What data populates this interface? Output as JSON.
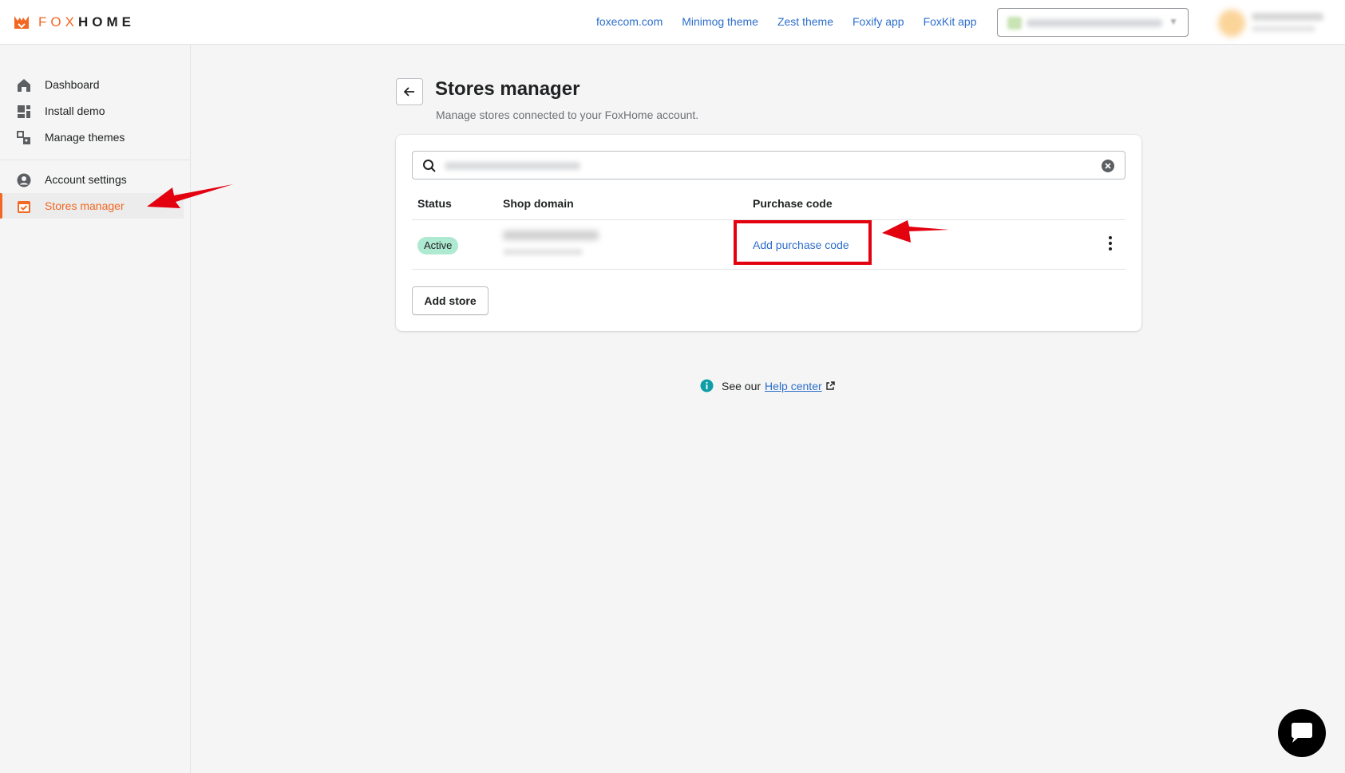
{
  "brand": {
    "name_fox": "FOX",
    "name_home": "HOME",
    "accent": "#f26722",
    "link_color": "#2c6ecb"
  },
  "top_nav": {
    "links": [
      "foxecom.com",
      "Minimog theme",
      "Zest theme",
      "Foxify app",
      "FoxKit app"
    ]
  },
  "sidebar": {
    "items": [
      {
        "label": "Dashboard",
        "icon": "home-icon"
      },
      {
        "label": "Install demo",
        "icon": "layout-icon"
      },
      {
        "label": "Manage themes",
        "icon": "themes-icon"
      },
      {
        "label": "Account settings",
        "icon": "account-icon"
      },
      {
        "label": "Stores manager",
        "icon": "store-icon",
        "active": true
      }
    ]
  },
  "page": {
    "title": "Stores manager",
    "subtitle": "Manage stores connected to your FoxHome account."
  },
  "table": {
    "headers": {
      "status": "Status",
      "domain": "Shop domain",
      "purchase": "Purchase code"
    },
    "rows": [
      {
        "status": "Active",
        "purchase_link": "Add purchase code"
      }
    ]
  },
  "actions": {
    "add_store": "Add store"
  },
  "help": {
    "prefix": "See our",
    "link": "Help center"
  },
  "annotation_color": "#e3000f"
}
